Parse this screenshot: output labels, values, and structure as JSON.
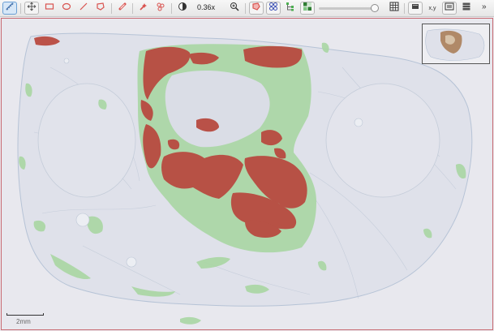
{
  "toolbar": {
    "zoom_level": "0.36x",
    "more_label": "»",
    "xy_label": "x,y"
  },
  "scalebar": {
    "label": "2mm"
  },
  "icons": [
    "ruler-icon",
    "move-icon",
    "rectangle-icon",
    "ellipse-icon",
    "line-icon",
    "polygon-icon",
    "brush-icon",
    "wand-icon",
    "cells-icon",
    "contrast-icon",
    "zoom-icon",
    "annotations-icon",
    "detections-icon",
    "tree-icon",
    "overlay-icon",
    "grid-icon",
    "screenshot-icon",
    "coordinates-icon",
    "overview-icon",
    "table-icon",
    "more-icon"
  ],
  "colors": {
    "accent": "#d9534f",
    "active_tool": "#6a9fd4",
    "tumor": "#b84a40",
    "stroma": "#8ccc86",
    "tissue_outline": "#a7b6cc"
  }
}
